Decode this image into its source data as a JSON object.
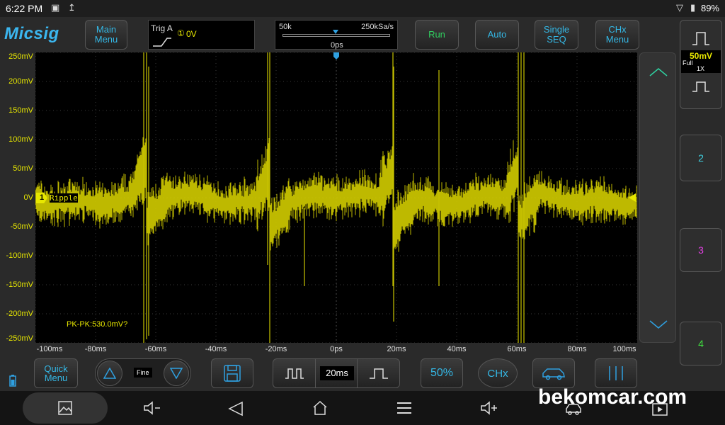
{
  "status_bar": {
    "time": "6:22 PM",
    "battery": "89%",
    "icons": [
      "image-icon",
      "upload-icon",
      "wifi-icon",
      "battery-icon"
    ]
  },
  "app": {
    "logo": "Micsig"
  },
  "toolbar": {
    "main_menu": "Main\nMenu",
    "trigger_label": "Trig A",
    "trigger_channel": "①",
    "trigger_level": "0V",
    "timebase_left": "50k",
    "timebase_right": "250kSa/s",
    "trigger_position": "0ps",
    "run": "Run",
    "auto": "Auto",
    "single_seq": "Single\nSEQ",
    "chx_menu": "CHx\nMenu"
  },
  "plot": {
    "y_labels": [
      "250mV",
      "200mV",
      "150mV",
      "100mV",
      "50mV",
      "0V",
      "-50mV",
      "-100mV",
      "-150mV",
      "-200mV",
      "-250mV"
    ],
    "x_labels": [
      "-100ms",
      "-80ms",
      "-60ms",
      "-40ms",
      "-20ms",
      "0ps",
      "20ms",
      "40ms",
      "60ms",
      "80ms",
      "100ms"
    ],
    "channel_marker": "1",
    "channel_name": "Ripple",
    "measurement": "PK-PK:530.0mV?",
    "trace_color": "#c8c300"
  },
  "right_panel": {
    "ch1_scale": "50mV",
    "ch1_bw": "Full",
    "ch1_probe": "1X",
    "ch2": "2",
    "ch3": "3",
    "ch4": "4",
    "ch2_color": "#3fd0e0",
    "ch3_color": "#e040e0",
    "ch4_color": "#40e040"
  },
  "bottom": {
    "quick_menu": "Quick\nMenu",
    "fine": "Fine",
    "timebase": "20ms",
    "percent": "50%",
    "chx": "CHx"
  },
  "watermark": "bekomcar.com"
}
